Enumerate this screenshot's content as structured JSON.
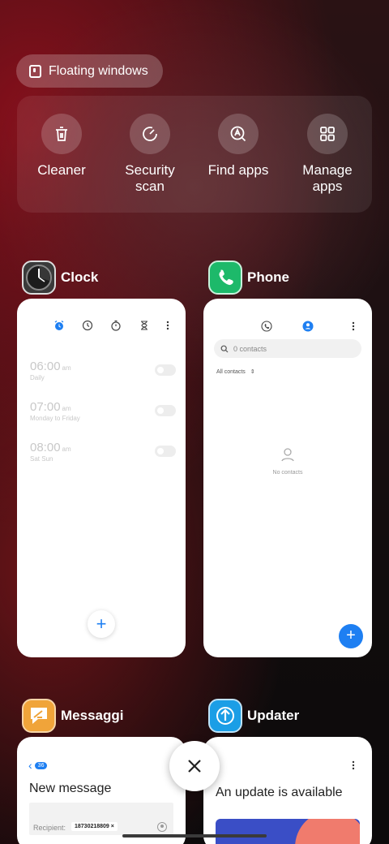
{
  "floating_windows": {
    "label": "Floating windows",
    "icon": "floating-window-icon"
  },
  "quick_actions": [
    {
      "label": "Cleaner",
      "icon": "trash-icon"
    },
    {
      "label": "Security\nscan",
      "icon": "security-scan-icon"
    },
    {
      "label": "Find apps",
      "icon": "find-apps-icon"
    },
    {
      "label": "Manage\napps",
      "icon": "grid-icon"
    }
  ],
  "apps": {
    "clock": {
      "name": "Clock",
      "alarms": [
        {
          "time": "06:00",
          "ampm": "am",
          "repeat": "Daily"
        },
        {
          "time": "07:00",
          "ampm": "am",
          "repeat": "Monday to Friday"
        },
        {
          "time": "08:00",
          "ampm": "am",
          "repeat": "Sat Sun"
        }
      ],
      "add_label": "+"
    },
    "phone": {
      "name": "Phone",
      "search_placeholder": "0 contacts",
      "filter_label": "All contacts",
      "empty_label": "No contacts",
      "add_label": "+"
    },
    "messaggi": {
      "name": "Messaggi",
      "back_count": "36",
      "title": "New message",
      "recipient_label": "Recipient:",
      "recipient_chip": "18730218809 ×"
    },
    "updater": {
      "name": "Updater",
      "title": "An update is available"
    }
  },
  "colors": {
    "accent": "#1e7ff2",
    "background": "#1a0f11"
  }
}
